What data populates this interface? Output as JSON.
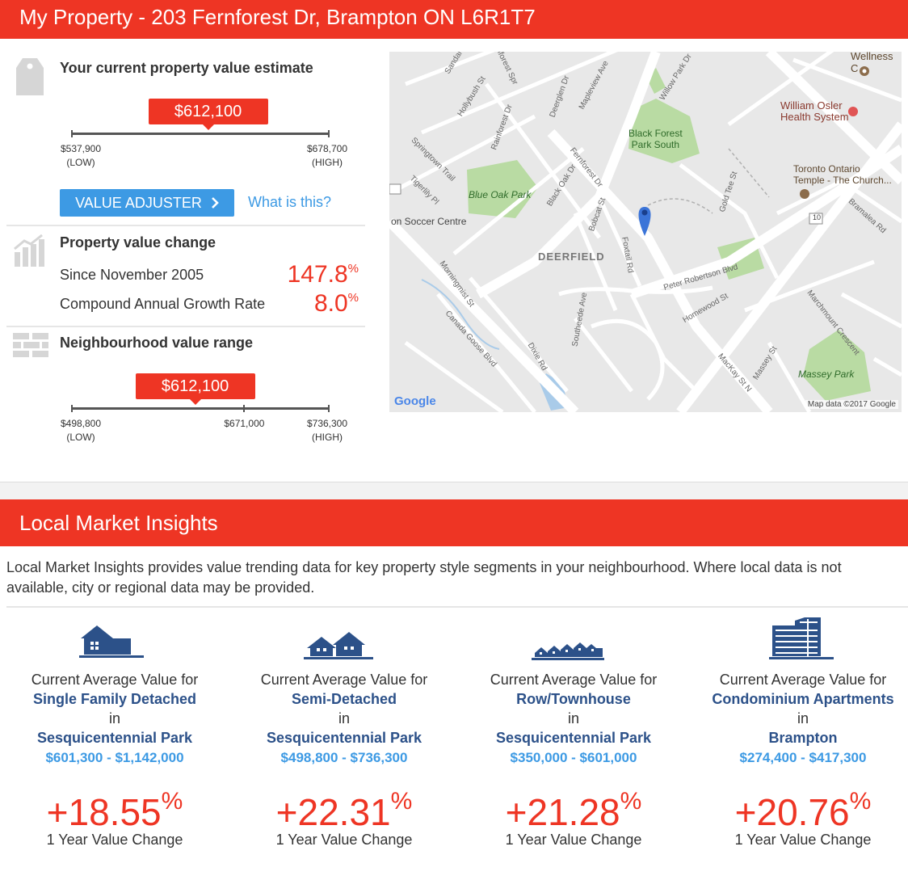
{
  "header": {
    "title": "My Property - 203 Fernforest Dr, Brampton ON L6R1T7"
  },
  "estimate": {
    "title": "Your current property value estimate",
    "value": "$612,100",
    "position": 0.53,
    "low": "$537,900",
    "low_label": "(LOW)",
    "high": "$678,700",
    "high_label": "(HIGH)",
    "adjuster_label": "VALUE ADJUSTER",
    "what_is_this": "What is this?"
  },
  "value_change": {
    "title": "Property value change",
    "since_label": "Since November 2005",
    "since_value": "147.8",
    "since_unit": "%",
    "cagr_label": "Compound Annual Growth Rate",
    "cagr_value": "8.0",
    "cagr_unit": "%"
  },
  "neighbourhood": {
    "title": "Neighbourhood value range",
    "value": "$612,100",
    "position": 0.48,
    "mid_position": 0.67,
    "low": "$498,800",
    "low_label": "(LOW)",
    "mid": "$671,000",
    "high": "$736,300",
    "high_label": "(HIGH)"
  },
  "map": {
    "attribution": "Map data ©2017 Google",
    "logo": "Google",
    "area_label": "DEERFIELD",
    "poi": [
      "Wellness C",
      "William Osler",
      "Health System",
      "Black Forest",
      "Park South",
      "Toronto Ontario",
      "Temple - The Church...",
      "Blue Oak Park",
      "Massey Park",
      "on Soccer Centre"
    ],
    "streets": [
      "Fernforest Dr",
      "Peter Robertson Blvd",
      "Bramalea Rd",
      "Dixie Rd",
      "Homewood St",
      "MacKay St N",
      "Massey St",
      "Black Oak Dr",
      "Canada Goose Blvd",
      "Morningmist St",
      "Bobcat St",
      "Foxtail Rd",
      "Southeede Ave",
      "Gold Tee St",
      "Marchmount Crescent",
      "Springtown Trail",
      "Tigerlily Pl",
      "Hollybush St",
      "Rainforest Dr",
      "Deerglen Dr",
      "Mapleview Ave",
      "Willow Park Dr",
      "Sandal",
      "Fernforest Spr",
      "10"
    ]
  },
  "insights": {
    "title": "Local Market Insights",
    "intro": "Local Market Insights provides value trending data for key property style segments in your neighbourhood. Where local data is not available, city or regional data may be provided.",
    "prefix": "Current Average Value for",
    "in_word": "in",
    "change_label": "1 Year Value Change",
    "cards": [
      {
        "icon": "detached-house-icon",
        "type": "Single Family Detached",
        "area": "Sesquicentennial Park",
        "range": "$601,300 - $1,142,000",
        "change": "+18.55",
        "unit": "%"
      },
      {
        "icon": "semi-detached-icon",
        "type": "Semi-Detached",
        "area": "Sesquicentennial Park",
        "range": "$498,800 - $736,300",
        "change": "+22.31",
        "unit": "%"
      },
      {
        "icon": "townhouse-icon",
        "type": "Row/Townhouse",
        "area": "Sesquicentennial Park",
        "range": "$350,000 - $601,000",
        "change": "+21.28",
        "unit": "%"
      },
      {
        "icon": "condo-building-icon",
        "type": "Condominium Apartments",
        "area": "Brampton",
        "range": "$274,400 - $417,300",
        "change": "+20.76",
        "unit": "%"
      }
    ]
  },
  "colors": {
    "accent": "#ee3524",
    "link": "#3d9ae4",
    "navy": "#2c5189",
    "text": "#333333"
  }
}
